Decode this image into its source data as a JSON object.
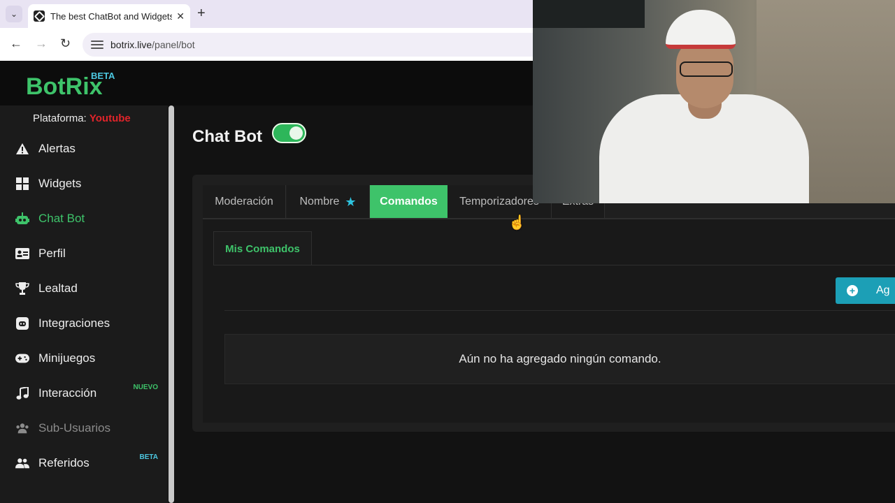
{
  "browser": {
    "tab_title": "The best ChatBot and Widgets",
    "url_domain": "botrix.live",
    "url_path": "/panel/bot"
  },
  "app": {
    "logo": "BotRix",
    "logo_badge": "BETA",
    "platform_label": "Plataforma:",
    "platform_value": "Youtube"
  },
  "sidebar": {
    "items": [
      {
        "label": "Alertas",
        "icon": "warning-icon"
      },
      {
        "label": "Widgets",
        "icon": "widgets-icon"
      },
      {
        "label": "Chat Bot",
        "icon": "robot-icon",
        "active": true
      },
      {
        "label": "Perfil",
        "icon": "id-card-icon"
      },
      {
        "label": "Lealtad",
        "icon": "trophy-icon"
      },
      {
        "label": "Integraciones",
        "icon": "discord-icon"
      },
      {
        "label": "Minijuegos",
        "icon": "gamepad-icon"
      },
      {
        "label": "Interacción",
        "icon": "music-icon",
        "badge": "NUEVO"
      },
      {
        "label": "Sub-Usuarios",
        "icon": "users-icon",
        "disabled": true
      },
      {
        "label": "Referidos",
        "icon": "user-group-icon",
        "badge": "BETA"
      }
    ]
  },
  "main": {
    "title": "Chat Bot",
    "toggle_on": true,
    "tabs": [
      "Moderación",
      "Nombre",
      "Comandos",
      "Temporizadores",
      "Extras"
    ],
    "active_tab": "Comandos",
    "subtab": "Mis Comandos",
    "add_button": "Ag",
    "empty_message": "Aún no ha agregado ningún comando."
  },
  "colors": {
    "accent": "#3ec36a",
    "info": "#1c9fb6",
    "platform": "#e0242a"
  }
}
